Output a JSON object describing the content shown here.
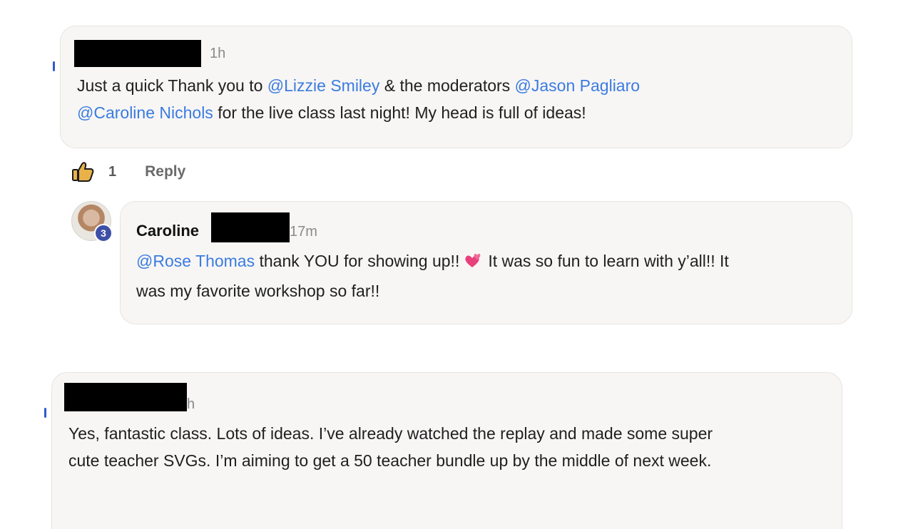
{
  "comments": [
    {
      "time": "1h",
      "body": [
        {
          "text": "Just a quick Thank you to ",
          "type": "text"
        },
        {
          "text": "@Lizzie Smiley",
          "type": "mention"
        },
        {
          "text": " & the moderators ",
          "type": "text"
        },
        {
          "text": "@Jason Pagliaro",
          "type": "mention"
        },
        {
          "text": "@Caroline Nichols",
          "type": "mention"
        },
        {
          "text": " for the live class last night! My head is full of ideas!",
          "type": "text"
        }
      ],
      "likes": "1",
      "reply_label": "Reply"
    },
    {
      "author": "Caroline",
      "time": "17m",
      "avatar_badge": "3",
      "body": [
        {
          "text": "@Rose Thomas",
          "type": "mention"
        },
        {
          "text": " thank YOU for showing up!!",
          "type": "text"
        },
        {
          "text": "two-hearts-emoji",
          "type": "emoji"
        },
        {
          "text": "It was so fun to learn with y’all!! It",
          "type": "text"
        },
        {
          "text": "was my favorite workshop so far!!",
          "type": "text"
        }
      ]
    },
    {
      "time_partial": "h",
      "body": [
        {
          "text": "Yes, fantastic class. Lots of ideas. I’ve already watched the replay and made some super",
          "type": "text"
        },
        {
          "text": "cute teacher SVGs. I’m aiming to get a 50 teacher bundle up by the middle of next week.",
          "type": "text"
        }
      ]
    }
  ],
  "colors": {
    "mention": "#3b7be0",
    "bubble_bg": "#f7f6f5",
    "badge": "#3d4fa6",
    "like_icon": "#e8b24a"
  }
}
